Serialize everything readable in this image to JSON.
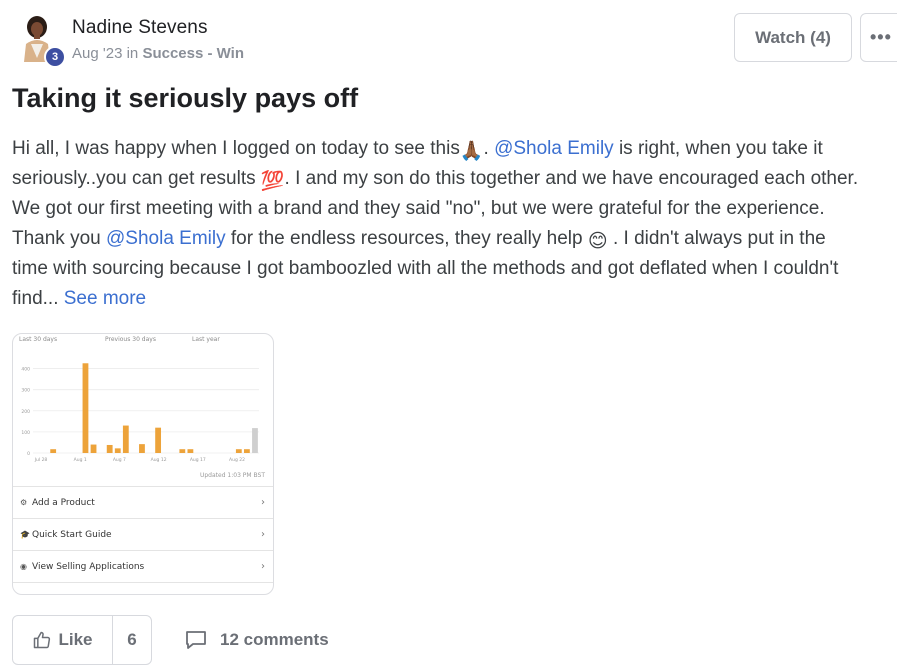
{
  "author": {
    "name": "Nadine Stevens",
    "level": "3",
    "date": "Aug '23",
    "in_word": "in",
    "category": "Success - Win"
  },
  "header_actions": {
    "watch_label": "Watch (4)",
    "more_label": "•••"
  },
  "post": {
    "title": "Taking it seriously pays off",
    "line1_a": "Hi all, I was happy when I logged on today to see this",
    "line1_b": ". ",
    "mention1": "@Shola Emily",
    "line1_c": " is right, when you take it",
    "line2_a": "seriously..you can get results ",
    "line2_b": ". I and my son do this together and we have encouraged each other.",
    "line3": "We got our first meeting with a brand and they said \"no\", but we were grateful for the experience.",
    "line4_a": "Thank you ",
    "mention2": "@Shola Emily",
    "line4_b": " for the endless resources, they really help ",
    "line4_c": " . I didn't always put in the",
    "line5": "time with sourcing because I got bamboozled with all the methods and got deflated when I couldn't",
    "line6_a": "find... ",
    "see_more": "See more",
    "emoji_pray": "🙏🏾",
    "emoji_100": "💯",
    "emoji_smile": "😊"
  },
  "attachment": {
    "tabs": [
      "Last 30 days",
      "Previous 30 days",
      "Last year"
    ],
    "updated": "Updated 1:03 PM BST",
    "menu": [
      {
        "icon": "⚙",
        "label": "Add a Product",
        "name": "add-product"
      },
      {
        "icon": "🎓",
        "label": "Quick Start Guide",
        "name": "quick-start-guide"
      },
      {
        "icon": "◉",
        "label": "View Selling Applications",
        "name": "view-selling-applications"
      }
    ]
  },
  "chart_data": {
    "type": "bar",
    "y_ticks": [
      "400",
      "300",
      "200",
      "100",
      "0"
    ],
    "x_labels": [
      "Jul 28",
      "Aug 1",
      "Aug 7",
      "Aug 12",
      "Aug 17",
      "Aug 22"
    ],
    "values": [
      0,
      0,
      18,
      0,
      0,
      0,
      425,
      40,
      0,
      38,
      22,
      130,
      0,
      42,
      0,
      120,
      0,
      0,
      18,
      18,
      0,
      0,
      0,
      0,
      0,
      18,
      18,
      118
    ],
    "ylim": [
      0,
      450
    ],
    "bar_color": "#eda33a",
    "last_color": "#cfcfcf"
  },
  "actions": {
    "like_label": "Like",
    "like_count": "6",
    "comments_label": "12 comments"
  }
}
